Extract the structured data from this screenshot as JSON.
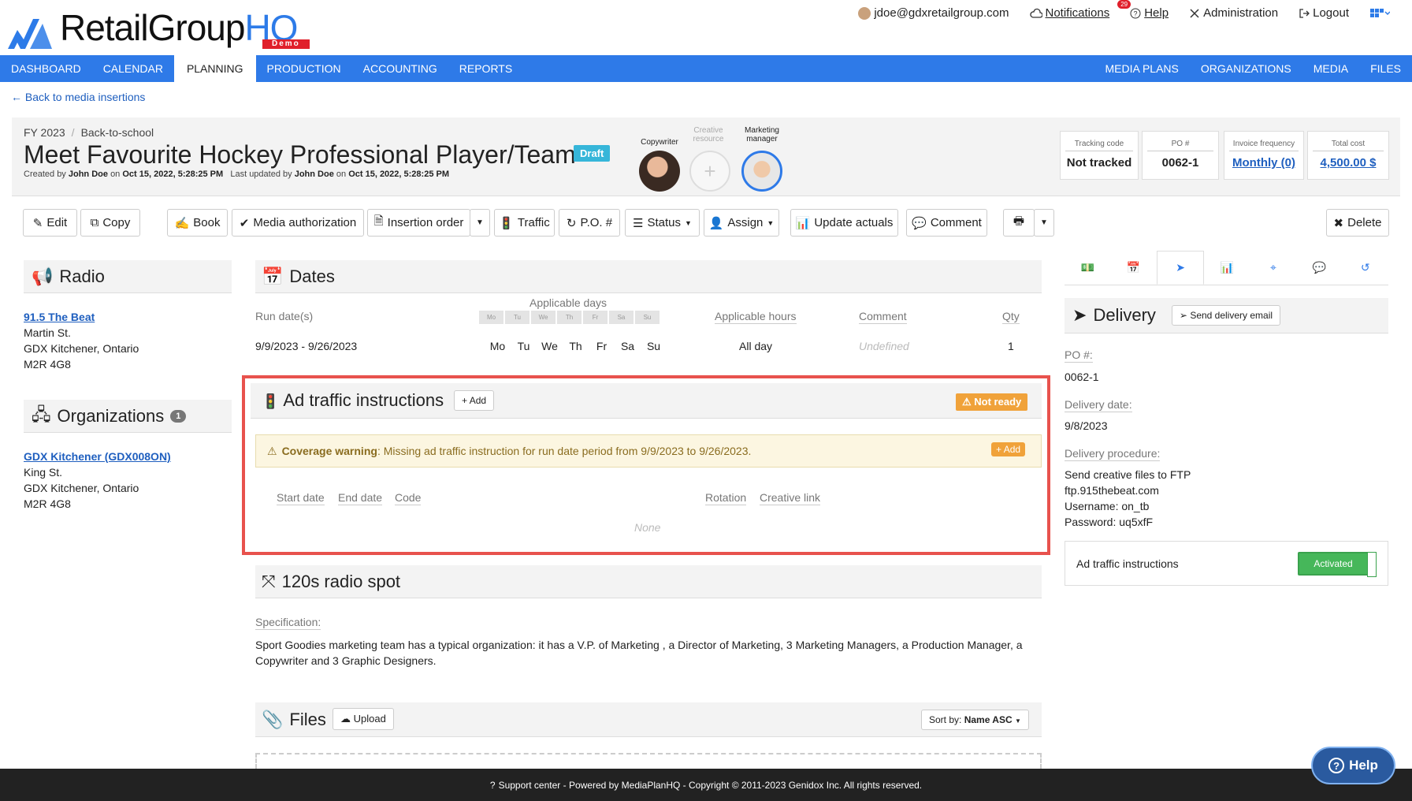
{
  "brand": {
    "name_a": "RetailGroup",
    "name_b": "HQ",
    "demo": "Demo"
  },
  "toplinks": {
    "user": "jdoe@gdxretailgroup.com",
    "notifications": "Notifications",
    "notif_count": "29",
    "help": "Help",
    "admin": "Administration",
    "logout": "Logout"
  },
  "nav": {
    "left": [
      "DASHBOARD",
      "CALENDAR",
      "PLANNING",
      "PRODUCTION",
      "ACCOUNTING",
      "REPORTS"
    ],
    "right": [
      "MEDIA PLANS",
      "ORGANIZATIONS",
      "MEDIA",
      "FILES"
    ],
    "active": "PLANNING"
  },
  "back": "Back to media insertions",
  "header": {
    "fy": "FY 2023",
    "campaign": "Back-to-school",
    "title": "Meet Favourite Hockey Professional Player/Team",
    "status": "Draft",
    "created_prefix": "Created by",
    "created_by": "John Doe",
    "created_on_prefix": "on",
    "created_on": "Oct 15, 2022, 5:28:25 PM",
    "updated_prefix": "Last updated by",
    "updated_by": "John Doe",
    "updated_on_prefix": "on",
    "updated_on": "Oct 15, 2022, 5:28:25 PM",
    "roles": {
      "copywriter": "Copywriter",
      "creative": "Creative resource",
      "marketing": "Marketing manager"
    },
    "stats": [
      {
        "label": "Tracking code",
        "value": "Not tracked"
      },
      {
        "label": "PO #",
        "value": "0062-1"
      },
      {
        "label": "Invoice frequency",
        "value": "Monthly (0)"
      },
      {
        "label": "Total cost",
        "value": "4,500.00 $"
      }
    ]
  },
  "toolbar": {
    "edit": "Edit",
    "copy": "Copy",
    "book": "Book",
    "media_auth": "Media authorization",
    "insertion_order": "Insertion order",
    "traffic": "Traffic",
    "po": "P.O. #",
    "status": "Status",
    "assign": "Assign",
    "update_actuals": "Update actuals",
    "comment": "Comment",
    "delete": "Delete"
  },
  "radio": {
    "heading": "Radio",
    "station": "91.5 The Beat",
    "street": "Martin St.",
    "city": "GDX Kitchener, Ontario",
    "postal": "M2R 4G8"
  },
  "orgs": {
    "heading": "Organizations",
    "count": "1",
    "name": "GDX Kitchener (GDX008ON)",
    "street": "King St.",
    "city": "GDX Kitchener, Ontario",
    "postal": "M2R 4G8"
  },
  "dates": {
    "heading": "Dates",
    "cols": {
      "run": "Run date(s)",
      "days": "Applicable days",
      "hours": "Applicable hours",
      "comment": "Comment",
      "qty": "Qty"
    },
    "day_abbr": [
      "Mo",
      "Tu",
      "We",
      "Th",
      "Fr",
      "Sa",
      "Su"
    ],
    "row": {
      "run": "9/9/2023 - 9/26/2023",
      "hours": "All day",
      "comment": "Undefined",
      "qty": "1"
    }
  },
  "adtraffic": {
    "heading": "Ad traffic instructions",
    "add": "Add",
    "status": "Not ready",
    "warning_bold": "Coverage warning",
    "warning_text": ": Missing ad traffic instruction for run date period from 9/9/2023 to 9/26/2023.",
    "cols": [
      "Start date",
      "End date",
      "Code",
      "Rotation",
      "Creative link"
    ],
    "empty": "None"
  },
  "spot": {
    "heading": "120s radio spot",
    "spec_label": "Specification:",
    "spec_line1": "Sport Goodies marketing team has a typical organization: it has a V.P. of Marketing , a Director of Marketing, 3 Marketing Managers, a Production Manager, a",
    "spec_line2": "Copywriter and 3 Graphic Designers."
  },
  "files": {
    "heading": "Files",
    "upload": "Upload",
    "sort_prefix": "Sort by:",
    "sort_value": "Name ASC"
  },
  "delivery": {
    "heading": "Delivery",
    "send": "Send delivery email",
    "po_label": "PO #:",
    "po": "0062-1",
    "date_label": "Delivery date:",
    "date": "9/8/2023",
    "proc_label": "Delivery procedure:",
    "proc": [
      "Send creative files to FTP",
      "ftp.915thebeat.com",
      "Username: on_tb",
      "Password: uq5xfF"
    ],
    "at_label": "Ad traffic instructions",
    "at_toggle": "Activated"
  },
  "footer": "Support center - Powered by MediaPlanHQ - Copyright © 2011-2023 Genidox Inc. All rights reserved.",
  "help_button": "Help"
}
